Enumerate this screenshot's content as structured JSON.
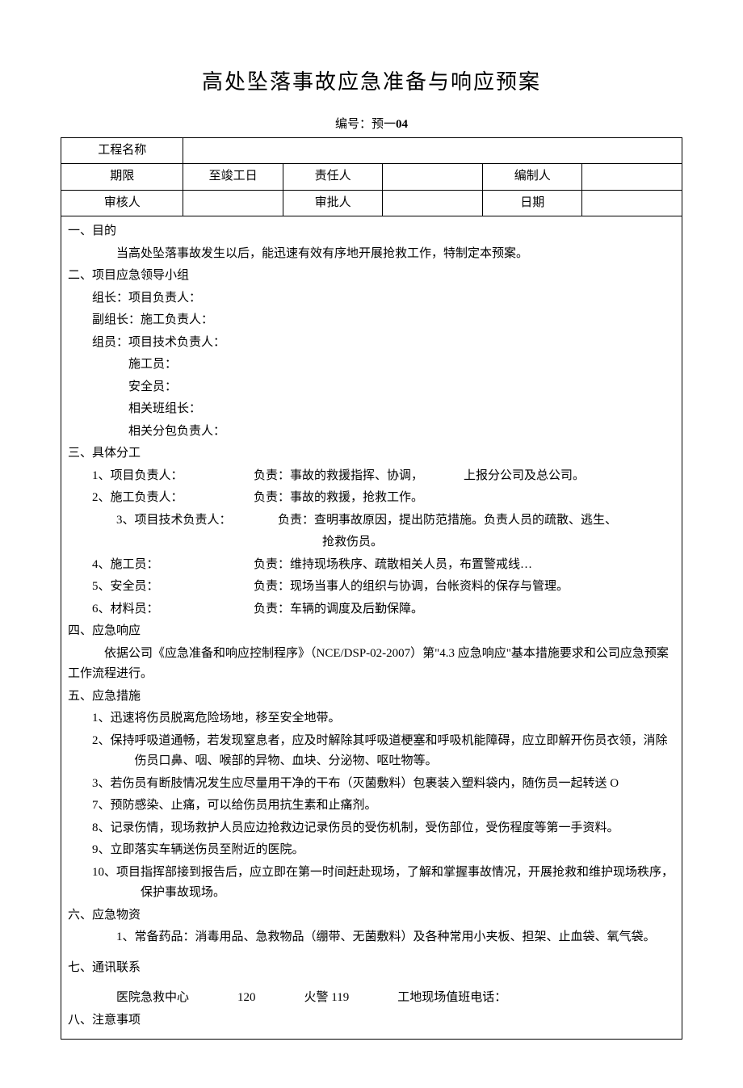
{
  "title": "高处坠落事故应急准备与响应预案",
  "doc_number_label": "编号：预一",
  "doc_number": "04",
  "header": {
    "r1c1": "工程名称",
    "r2c1": "期限",
    "r2c2": "至竣工日",
    "r2c3": "责任人",
    "r2c5": "编制人",
    "r3c1": "审核人",
    "r3c3": "审批人",
    "r3c5": "日期"
  },
  "s1": {
    "h": "一、目的",
    "p": "当高处坠落事故发生以后，能迅速有效有序地开展抢救工作，特制定本预案。"
  },
  "s2": {
    "h": "二、项目应急领导小组",
    "l1": "组长：项目负责人：",
    "l2": "副组长：施工负责人：",
    "l3": "组员：项目技术负责人：",
    "l4": "施工员：",
    "l5": "安全员：",
    "l6": "相关班组长：",
    "l7": "相关分包负责人："
  },
  "s3": {
    "h": "三、具体分工",
    "r1a": "1、项目负责人：",
    "r1b": "负责：事故的救援指挥、协调，",
    "r1c": "上报分公司及总公司。",
    "r2a": "2、施工负责人：",
    "r2b": "负责：事故的救援，抢救工作。",
    "r3a": "3、项目技术负责人：",
    "r3b": "负责：查明事故原因，提出防范措施。负责人员的疏散、逃生、",
    "r3c": "抢救伤员。",
    "r4a": "4、施工员：",
    "r4b": "负责：维持现场秩序、疏散相关人员，布置警戒线…",
    "r5a": "5、安全员：",
    "r5b": "负责：现场当事人的组织与协调，台帐资料的保存与管理。",
    "r6a": "6、材料员：",
    "r6b": "负责：车辆的调度及后勤保障。"
  },
  "s4": {
    "h": "四、应急响应",
    "p": "依据公司《应急准备和响应控制程序》（NCE/DSP-02-2007）第\"4.3 应急响应\"基本措施要求和公司应急预案工作流程进行。"
  },
  "s5": {
    "h": "五、应急措施",
    "i1": "1、迅速将伤员脱离危险场地，移至安全地带。",
    "i2": "2、保持呼吸道通畅，若发现窒息者，应及时解除其呼吸道梗塞和呼吸机能障碍，应立即解开伤员衣领，消除伤员口鼻、咽、喉部的异物、血块、分泌物、呕吐物等。",
    "i3": "3、若伤员有断肢情况发生应尽量用干净的干布（灭菌敷料）包裹装入塑料袋内，随伤员一起转送 O",
    "i7": "7、预防感染、止痛，可以给伤员用抗生素和止痛剂。",
    "i8": "8、记录伤情，现场救护人员应边抢救边记录伤员的受伤机制，受伤部位，受伤程度等第一手资料。",
    "i9": "9、立即落实车辆送伤员至附近的医院。",
    "i10": "10、项目指挥部接到报告后，应立即在第一时间赶赴现场，了解和掌握事故情况，开展抢救和维护现场秩序，保护事故现场。"
  },
  "s6": {
    "h": "六、应急物资",
    "p": "1、常备药品：消毒用品、急救物品（绷带、无菌敷料）及各种常用小夹板、担架、止血袋、氧气袋。"
  },
  "s7": {
    "h": "七、通讯联系",
    "c1a": "医院急救中心",
    "c1b": "120",
    "c2a": "火警",
    "c2b": "119",
    "c3a": "工地现场值班电话："
  },
  "s8": {
    "h": "八、注意事项"
  }
}
